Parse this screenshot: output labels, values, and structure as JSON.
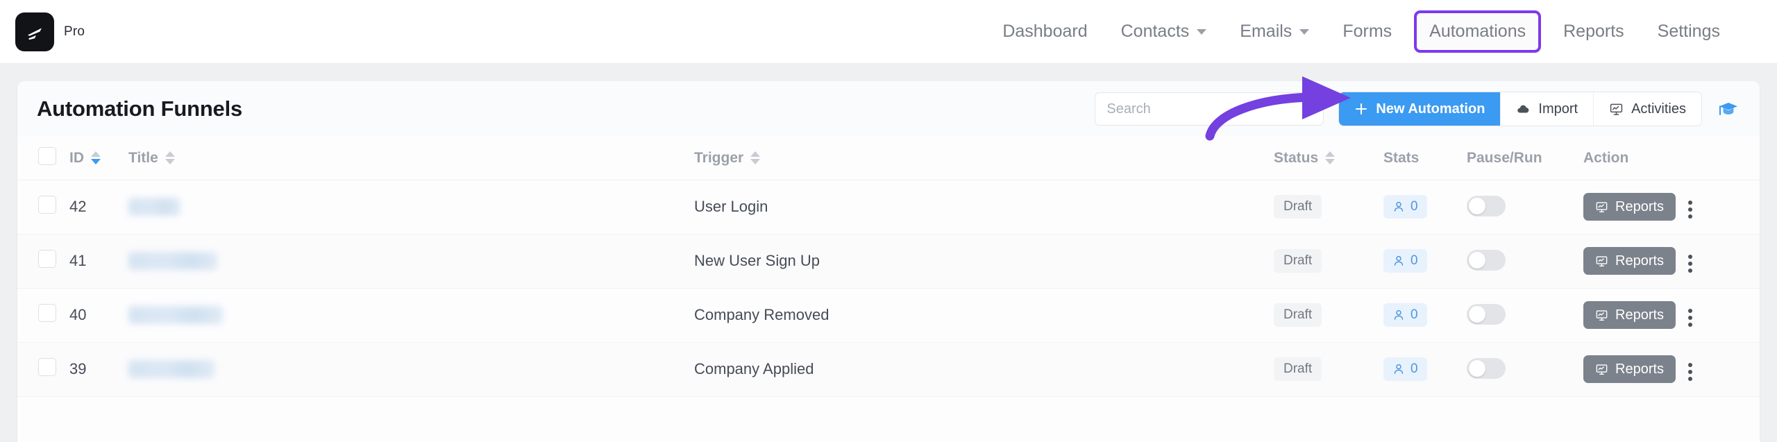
{
  "header": {
    "brand_label": "Pro",
    "logo_icon": "wing-logo-icon",
    "nav": [
      {
        "label": "Dashboard",
        "icon": "",
        "active": false
      },
      {
        "label": "Contacts",
        "icon": "chevron-down-icon",
        "active": false
      },
      {
        "label": "Emails",
        "icon": "chevron-down-icon",
        "active": false
      },
      {
        "label": "Forms",
        "icon": "",
        "active": false
      },
      {
        "label": "Automations",
        "icon": "",
        "active": true
      },
      {
        "label": "Reports",
        "icon": "",
        "active": false
      },
      {
        "label": "Settings",
        "icon": "",
        "active": false
      }
    ]
  },
  "panel": {
    "title": "Automation Funnels",
    "search": {
      "value": "",
      "placeholder": "Search",
      "icon": "search-input"
    },
    "buttons": {
      "new_automation": "New Automation",
      "new_automation_icon": "plus-icon",
      "import": "Import",
      "import_icon": "cloud-upload-icon",
      "activities": "Activities",
      "activities_icon": "presentation-chart-icon",
      "help_icon": "graduation-cap-icon"
    }
  },
  "table": {
    "columns": [
      {
        "label": "",
        "name": "select-all-checkbox",
        "sort": "none"
      },
      {
        "label": "ID",
        "name": "column-id",
        "sort": "desc"
      },
      {
        "label": "Title",
        "name": "column-title",
        "sort": "none"
      },
      {
        "label": "Trigger",
        "name": "column-trigger",
        "sort": "none"
      },
      {
        "label": "Status",
        "name": "column-status",
        "sort": "none"
      },
      {
        "label": "Stats",
        "name": "column-stats",
        "sort": "none"
      },
      {
        "label": "Pause/Run",
        "name": "column-pause-run",
        "sort": "none"
      },
      {
        "label": "Action",
        "name": "column-action",
        "sort": "none"
      }
    ],
    "rows": [
      {
        "id": "42",
        "title": "",
        "title_redacted": true,
        "title_width": 75,
        "trigger": "User Login",
        "status": "Draft",
        "stats": "0",
        "toggle_on": false,
        "action_label": "Reports"
      },
      {
        "id": "41",
        "title": "",
        "title_redacted": true,
        "title_width": 128,
        "trigger": "New User Sign Up",
        "status": "Draft",
        "stats": "0",
        "toggle_on": false,
        "action_label": "Reports"
      },
      {
        "id": "40",
        "title": "",
        "title_redacted": true,
        "title_width": 136,
        "trigger": "Company Removed",
        "status": "Draft",
        "stats": "0",
        "toggle_on": false,
        "action_label": "Reports"
      },
      {
        "id": "39",
        "title": "",
        "title_redacted": true,
        "title_width": 124,
        "trigger": "Company Applied",
        "status": "Draft",
        "stats": "0",
        "toggle_on": false,
        "action_label": "Reports"
      }
    ],
    "row_menu_icon": "kebab-menu-icon",
    "stats_icon": "user-icon",
    "action_icon": "presentation-chart-icon"
  },
  "annotations": {
    "highlight_color": "#7c3aed",
    "arrow_name": "arrow-pointing-to-new-automation",
    "accent_color": "#3b9af2"
  }
}
